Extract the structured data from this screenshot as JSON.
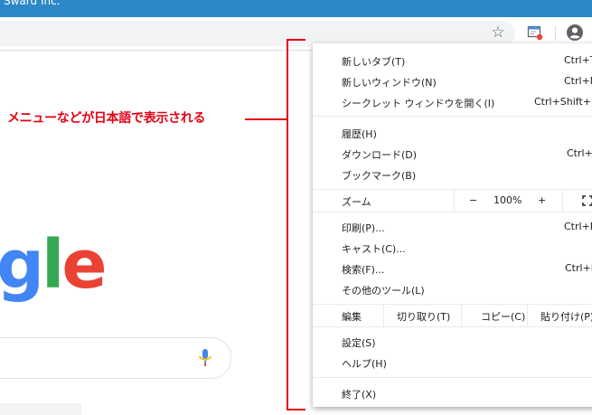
{
  "window": {
    "title": "Sward Inc."
  },
  "toolbar": {
    "bookmark_icon": "star-icon",
    "extension_icon": "extension-icon",
    "profile_icon": "account-circle-icon"
  },
  "annotation": {
    "text": "メニューなどが日本語で表示される",
    "color": "#e50012"
  },
  "page": {
    "logo": [
      "g",
      "l",
      "e"
    ],
    "logo_colors": [
      "#4285f4",
      "#34a853",
      "#ea4335"
    ]
  },
  "menu": {
    "items": [
      {
        "label": "新しいタブ(T)",
        "shortcut": "Ctrl+T"
      },
      {
        "label": "新しいウィンドウ(N)",
        "shortcut": "Ctrl+N"
      },
      {
        "label": "シークレット ウィンドウを開く(I)",
        "shortcut": "Ctrl+Shift+N"
      },
      {
        "label": "履歴(H)",
        "shortcut": ""
      },
      {
        "label": "ダウンロード(D)",
        "shortcut": "Ctrl+J"
      },
      {
        "label": "ブックマーク(B)",
        "shortcut": ""
      },
      {
        "label": "印刷(P)...",
        "shortcut": "Ctrl+P"
      },
      {
        "label": "キャスト(C)...",
        "shortcut": ""
      },
      {
        "label": "検索(F)...",
        "shortcut": "Ctrl+F"
      },
      {
        "label": "その他のツール(L)",
        "shortcut": ""
      },
      {
        "label": "設定(S)",
        "shortcut": ""
      },
      {
        "label": "ヘルプ(H)",
        "shortcut": ""
      },
      {
        "label": "終了(X)",
        "shortcut": ""
      }
    ],
    "zoom": {
      "label": "ズーム",
      "minus": "−",
      "value": "100%",
      "plus": "+"
    },
    "edit": {
      "label": "編集",
      "cut": "切り取り(T)",
      "copy": "コピー(C)",
      "paste": "貼り付け(P)"
    }
  }
}
